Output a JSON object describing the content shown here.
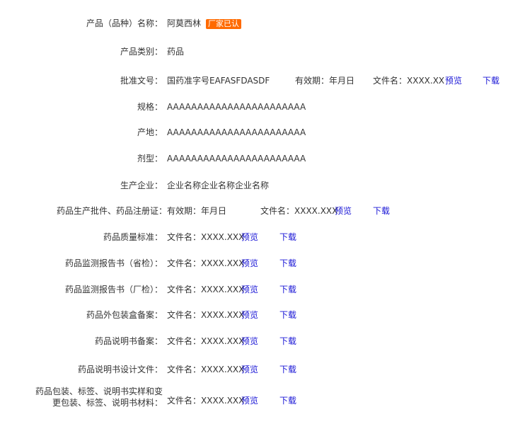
{
  "product_name": {
    "label": "产品（品种）名称：",
    "value": "阿莫西林",
    "badge": "厂家已认"
  },
  "category": {
    "label": "产品类别：",
    "value": "药品"
  },
  "approval": {
    "label": "批准文号：",
    "number": "国药准字号EAFASFDASDF",
    "validity": "有效期：年月日",
    "file": "文件名：XXXX.XX",
    "preview": "预览",
    "download": "下载"
  },
  "spec": {
    "label": "规格：",
    "value": "AAAAAAAAAAAAAAAAAAAAAAA"
  },
  "origin": {
    "label": "产地：",
    "value": "AAAAAAAAAAAAAAAAAAAAAAA"
  },
  "dosage": {
    "label": "剂型：",
    "value": "AAAAAAAAAAAAAAAAAAAAAAA"
  },
  "manufacturer": {
    "label": "生产企业：",
    "value": "企业名称企业名称企业名称"
  },
  "production_license": {
    "label": "药品生产批件、药品注册证：",
    "validity": "有效期：年月日",
    "file": "文件名：XXXX.XXX",
    "preview": "预览",
    "download": "下载"
  },
  "docs": [
    {
      "label": "药品质量标准：",
      "file": "文件名：XXXX.XXX",
      "preview": "预览",
      "download": "下载"
    },
    {
      "label": "药品监测报告书（省检）：",
      "file": "文件名：XXXX.XXX",
      "preview": "预览",
      "download": "下载"
    },
    {
      "label": "药品监测报告书（厂检）：",
      "file": "文件名：XXXX.XXX",
      "preview": "预览",
      "download": "下载"
    },
    {
      "label": "药品外包装盒备案：",
      "file": "文件名：XXXX.XXX",
      "preview": "预览",
      "download": "下载"
    },
    {
      "label": "药品说明书备案：",
      "file": "文件名：XXXX.XXX",
      "preview": "预览",
      "download": "下载"
    },
    {
      "label": "药品说明书设计文件：",
      "file": "文件名：XXXX.XXX",
      "preview": "预览",
      "download": "下载"
    }
  ],
  "packaging": {
    "label_line1": "药品包装、标签、说明书实样和变",
    "label_line2": "更包装、标签、说明书材料：",
    "file": "文件名：XXXX.XXX",
    "preview": "预览",
    "download": "下载"
  }
}
